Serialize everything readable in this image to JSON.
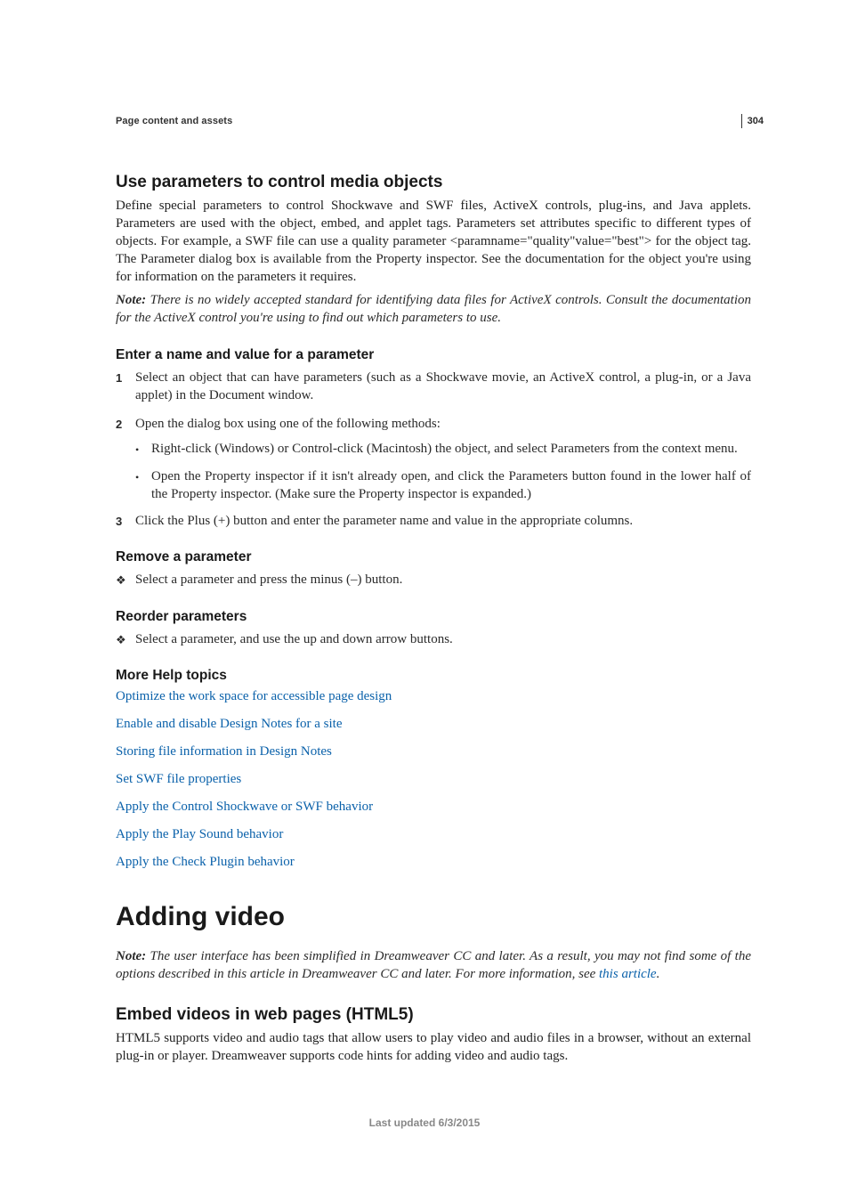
{
  "pageNumber": "304",
  "breadcrumb": "Page content and assets",
  "h2_1": "Use parameters to control media objects",
  "p_intro": "Define special parameters to control Shockwave and SWF files, ActiveX controls, plug-ins, and Java applets. Parameters are used with the object, embed, and applet tags. Parameters set attributes specific to different types of objects. For example, a SWF file can use a quality parameter <paramname=\"quality\"value=\"best\"> for the object tag. The Parameter dialog box is available from the Property inspector. See the documentation for the object you're using for information on the parameters it requires.",
  "note1_label": "Note: ",
  "note1_text": "There is no widely accepted standard for identifying data files for ActiveX controls. Consult the documentation for the ActiveX control you're using to find out which parameters to use.",
  "h3_enter": "Enter a name and value for a parameter",
  "steps": {
    "s1": "Select an object that can have parameters (such as a Shockwave movie, an ActiveX control, a plug-in, or a Java applet) in the Document window.",
    "s2": "Open the dialog box using one of the following methods:",
    "s2a": "Right-click (Windows) or Control-click (Macintosh) the object, and select Parameters from the context menu.",
    "s2b": "Open the Property inspector if it isn't already open, and click the Parameters button found in the lower half of the Property inspector. (Make sure the Property inspector is expanded.)",
    "s3": "Click the Plus (+) button and enter the parameter name and value in the appropriate columns."
  },
  "h3_remove": "Remove a parameter",
  "remove_text": "Select a parameter and press the minus (–) button.",
  "h3_reorder": "Reorder parameters",
  "reorder_text": "Select a parameter, and use the up and down arrow buttons.",
  "h3_more": "More Help topics",
  "links": {
    "l1": "Optimize the work space for accessible page design",
    "l2": "Enable and disable Design Notes for a site",
    "l3": "Storing file information in Design Notes",
    "l4": "Set SWF file properties",
    "l5": "Apply the Control Shockwave or SWF behavior",
    "l6": "Apply the Play Sound behavior",
    "l7": "Apply the Check Plugin behavior"
  },
  "h1_chapter": "Adding video",
  "note2_label": "Note: ",
  "note2_pre": "The user interface has been simplified in Dreamweaver CC and later. As a result, you may not find some of the options described in this article in Dreamweaver CC and later. For more information, see ",
  "note2_link": "this article",
  "note2_post": ".",
  "h2_embed": "Embed videos in web pages (HTML5)",
  "p_embed": "HTML5 supports video and audio tags that allow users to play video and audio files in a browser, without an external plug-in or player. Dreamweaver supports code hints for adding video and audio tags.",
  "footer": "Last updated 6/3/2015"
}
